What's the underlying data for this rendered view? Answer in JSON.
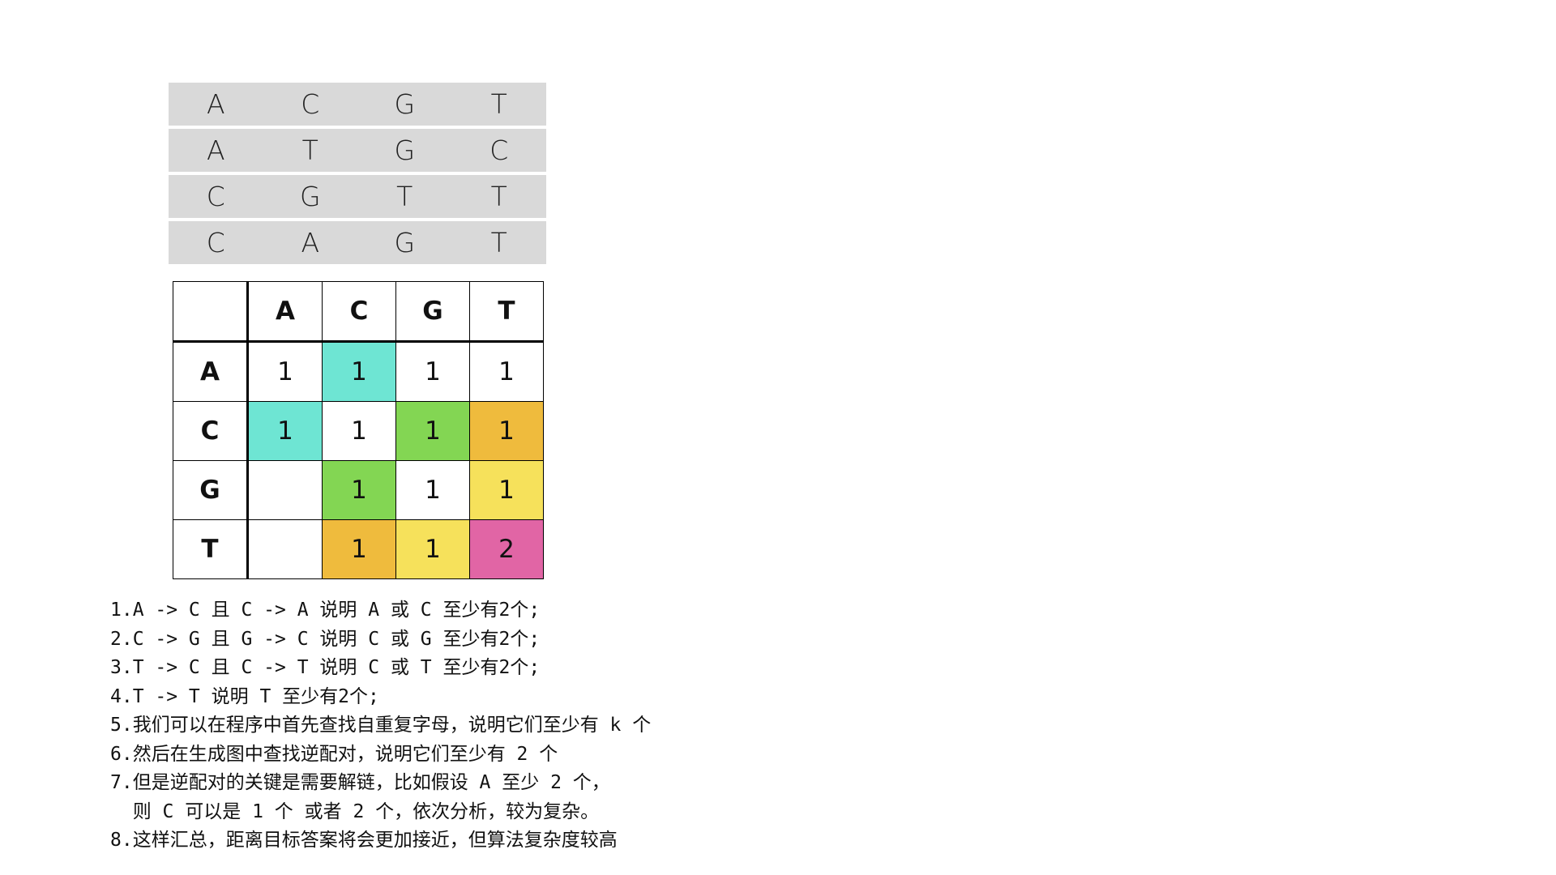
{
  "sequences": [
    [
      "A",
      "C",
      "G",
      "T"
    ],
    [
      "A",
      "T",
      "G",
      "C"
    ],
    [
      "C",
      "G",
      "T",
      "T"
    ],
    [
      "C",
      "A",
      "G",
      "T"
    ]
  ],
  "matrix": {
    "col_headers": [
      "A",
      "C",
      "G",
      "T"
    ],
    "rows": [
      {
        "label": "A",
        "cells": [
          {
            "value": "1",
            "color": "#ffffff"
          },
          {
            "value": "1",
            "color": "#6ee5d3"
          },
          {
            "value": "1",
            "color": "#ffffff"
          },
          {
            "value": "1",
            "color": "#ffffff"
          }
        ]
      },
      {
        "label": "C",
        "cells": [
          {
            "value": "1",
            "color": "#6ee5d3"
          },
          {
            "value": "1",
            "color": "#ffffff"
          },
          {
            "value": "1",
            "color": "#83d653"
          },
          {
            "value": "1",
            "color": "#efbb3d"
          }
        ]
      },
      {
        "label": "G",
        "cells": [
          {
            "value": "",
            "color": "#ffffff"
          },
          {
            "value": "1",
            "color": "#83d653"
          },
          {
            "value": "1",
            "color": "#ffffff"
          },
          {
            "value": "1",
            "color": "#f6e15b"
          }
        ]
      },
      {
        "label": "T",
        "cells": [
          {
            "value": "",
            "color": "#ffffff"
          },
          {
            "value": "1",
            "color": "#efbb3d"
          },
          {
            "value": "1",
            "color": "#f6e15b"
          },
          {
            "value": "2",
            "color": "#e165a5"
          }
        ]
      }
    ]
  },
  "notes": [
    "1.A -> C 且 C -> A 说明 A 或 C 至少有2个;",
    "2.C -> G 且 G -> C 说明 C 或 G 至少有2个;",
    "3.T -> C 且 C -> T 说明 C 或 T 至少有2个;",
    "4.T -> T 说明 T 至少有2个;",
    "5.我们可以在程序中首先查找自重复字母，说明它们至少有 k 个",
    "6.然后在生成图中查找逆配对，说明它们至少有 2 个",
    "7.但是逆配对的关键是需要解链，比如假设 A 至少 2 个，",
    "  则 C 可以是 1 个 或者 2 个，依次分析，较为复杂。",
    "8.这样汇总，距离目标答案将会更加接近，但算法复杂度较高"
  ]
}
